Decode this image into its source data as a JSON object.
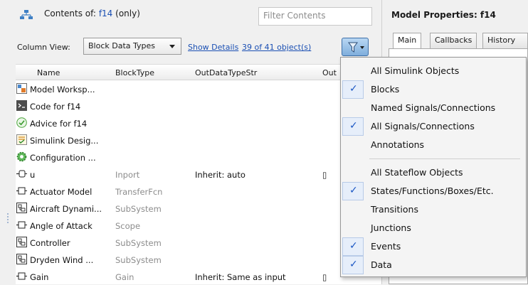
{
  "header": {
    "contents_prefix": "Contents of:",
    "contents_link": "f14",
    "contents_suffix": "(only)",
    "filter_placeholder": "Filter Contents"
  },
  "toolbar": {
    "column_view_label": "Column View:",
    "column_view_value": "Block Data Types",
    "show_details": "Show Details",
    "object_count": "39 of 41 object(s)"
  },
  "table": {
    "columns": [
      "Name",
      "BlockType",
      "OutDataTypeStr",
      "Out"
    ],
    "rows": [
      {
        "name": "Model Worksp...",
        "type": "",
        "out": "",
        "out2": "",
        "icon": "workspace-icon"
      },
      {
        "name": "Code for f14",
        "type": "",
        "out": "",
        "out2": "",
        "icon": "code-icon"
      },
      {
        "name": "Advice for f14",
        "type": "",
        "out": "",
        "out2": "",
        "icon": "advice-check-icon"
      },
      {
        "name": "Simulink Desig...",
        "type": "",
        "out": "",
        "out2": "",
        "icon": "design-verifier-icon"
      },
      {
        "name": "Configuration ...",
        "type": "",
        "out": "",
        "out2": "",
        "icon": "configuration-gear-icon"
      },
      {
        "name": "u",
        "type": "Inport",
        "out": "Inherit: auto",
        "out2": "▯",
        "icon": "inport-icon"
      },
      {
        "name": "Actuator Model",
        "type": "TransferFcn",
        "out": "",
        "out2": "",
        "icon": "block-icon"
      },
      {
        "name": "Aircraft Dynami...",
        "type": "SubSystem",
        "out": "",
        "out2": "",
        "icon": "subsystem-icon"
      },
      {
        "name": "Angle of  Attack",
        "type": "Scope",
        "out": "",
        "out2": "",
        "icon": "block-icon"
      },
      {
        "name": "Controller",
        "type": "SubSystem",
        "out": "",
        "out2": "",
        "icon": "subsystem-icon"
      },
      {
        "name": "Dryden Wind ...",
        "type": "SubSystem",
        "out": "",
        "out2": "",
        "icon": "subsystem-icon"
      },
      {
        "name": "Gain",
        "type": "Gain",
        "out": "Inherit: Same as input",
        "out2": "▯",
        "icon": "block-icon"
      }
    ]
  },
  "properties": {
    "title": "Model Properties: f14",
    "tabs": [
      "Main",
      "Callbacks",
      "History"
    ]
  },
  "menu": {
    "items": [
      {
        "label": "All Simulink Objects",
        "checked": false
      },
      {
        "label": "Blocks",
        "checked": true
      },
      {
        "label": "Named Signals/Connections",
        "checked": false
      },
      {
        "label": "All Signals/Connections",
        "checked": true
      },
      {
        "label": "Annotations",
        "checked": false
      },
      {
        "label": "All Stateflow Objects",
        "checked": false
      },
      {
        "label": "States/Functions/Boxes/Etc.",
        "checked": true
      },
      {
        "label": "Transitions",
        "checked": false
      },
      {
        "label": "Junctions",
        "checked": false
      },
      {
        "label": "Events",
        "checked": true
      },
      {
        "label": "Data",
        "checked": true
      }
    ],
    "check_glyph": "✓"
  },
  "colors": {
    "link": "#1a4fb3",
    "check": "#1a56c4",
    "muted_type": "#8c8c8c"
  }
}
